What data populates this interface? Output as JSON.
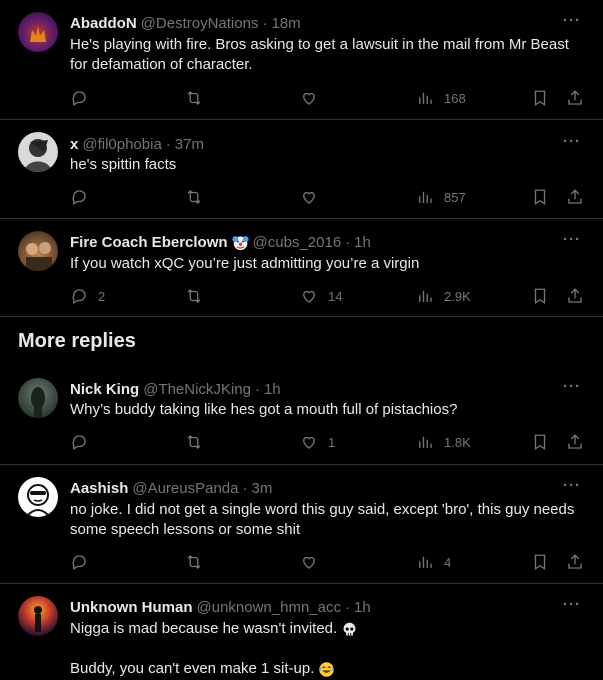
{
  "tweets": [
    {
      "name": "AbaddoN",
      "handle": "@DestroyNations",
      "time": "18m",
      "body_lines": [
        "He's playing with fire. Bros asking to get a lawsuit in the mail from Mr Beast",
        "for defamation of character."
      ],
      "replies": "",
      "retweets": "",
      "likes": "",
      "views": "168"
    },
    {
      "name": "x",
      "handle": "@fil0phobia",
      "time": "37m",
      "body_lines": [
        "he's spittin facts"
      ],
      "replies": "",
      "retweets": "",
      "likes": "",
      "views": "857"
    },
    {
      "name": "Fire Coach Eberclown",
      "handle": "@cubs_2016",
      "time": "1h",
      "body_lines": [
        "If you watch xQC you’re just admitting you’re a virgin"
      ],
      "replies": "2",
      "retweets": "",
      "likes": "14",
      "views": "2.9K"
    }
  ],
  "more_replies_label": "More replies",
  "more_tweets": [
    {
      "name": "Nick King",
      "handle": "@TheNickJKing",
      "time": "1h",
      "body_lines": [
        "Why’s buddy taking like hes got a mouth full of pistachios?"
      ],
      "replies": "",
      "retweets": "",
      "likes": "1",
      "views": "1.8K"
    },
    {
      "name": "Aashish",
      "handle": "@AureusPanda",
      "time": "3m",
      "body_lines": [
        "no joke. I did not get a single word this guy said, except 'bro', this guy needs",
        "some speech lessons or some shit"
      ],
      "replies": "",
      "retweets": "",
      "likes": "",
      "views": "4"
    },
    {
      "name": "Unknown Human",
      "handle": "@unknown_hmn_acc",
      "time": "1h",
      "body_lines": [
        "Nigga is mad because he wasn't invited.",
        "",
        "Buddy, you can't even make 1 sit-up."
      ],
      "replies": "",
      "retweets": "",
      "likes": "",
      "views": ""
    }
  ],
  "separator": "·",
  "more_glyph": "···",
  "icons": {
    "reply": "reply-icon",
    "retweet": "retweet-icon",
    "like": "heart-icon",
    "views": "views-icon",
    "bookmark": "bookmark-icon",
    "share": "share-icon"
  },
  "colors": {
    "background": "#000000",
    "text": "#e7e9ea",
    "muted": "#71767b",
    "divider": "#2f3336"
  }
}
